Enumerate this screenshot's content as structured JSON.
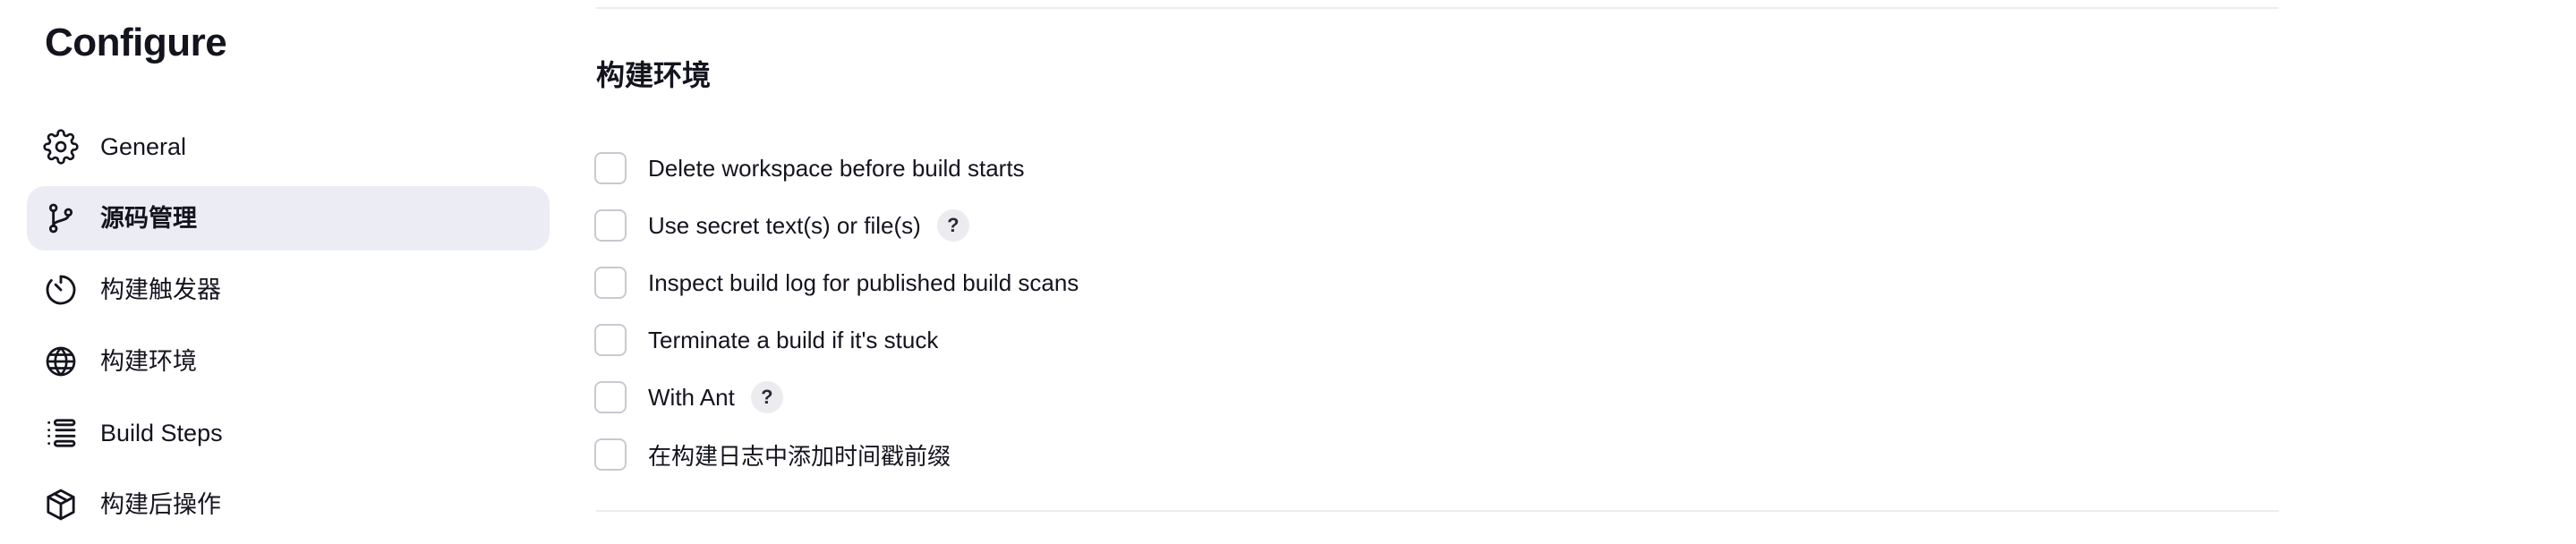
{
  "page": {
    "title": "Configure"
  },
  "sidebar": {
    "items": [
      {
        "label": "General",
        "icon": "gear-icon",
        "active": false
      },
      {
        "label": "源码管理",
        "icon": "source-branch-icon",
        "active": true
      },
      {
        "label": "构建触发器",
        "icon": "timer-icon",
        "active": false
      },
      {
        "label": "构建环境",
        "icon": "globe-icon",
        "active": false
      },
      {
        "label": "Build Steps",
        "icon": "list-icon",
        "active": false
      },
      {
        "label": "构建后操作",
        "icon": "package-icon",
        "active": false
      }
    ]
  },
  "section": {
    "title": "构建环境",
    "options": [
      {
        "label": "Delete workspace before build starts",
        "checked": false,
        "help": ""
      },
      {
        "label": "Use secret text(s) or file(s)",
        "checked": false,
        "help": "?"
      },
      {
        "label": "Inspect build log for published build scans",
        "checked": false,
        "help": ""
      },
      {
        "label": "Terminate a build if it's stuck",
        "checked": false,
        "help": ""
      },
      {
        "label": "With Ant",
        "checked": false,
        "help": "?"
      },
      {
        "label": "在构建日志中添加时间戳前缀",
        "checked": false,
        "help": ""
      }
    ]
  },
  "colors": {
    "active_bg": "#ececf5",
    "checkbox_border": "#c9c9d1",
    "text": "#14141f"
  }
}
